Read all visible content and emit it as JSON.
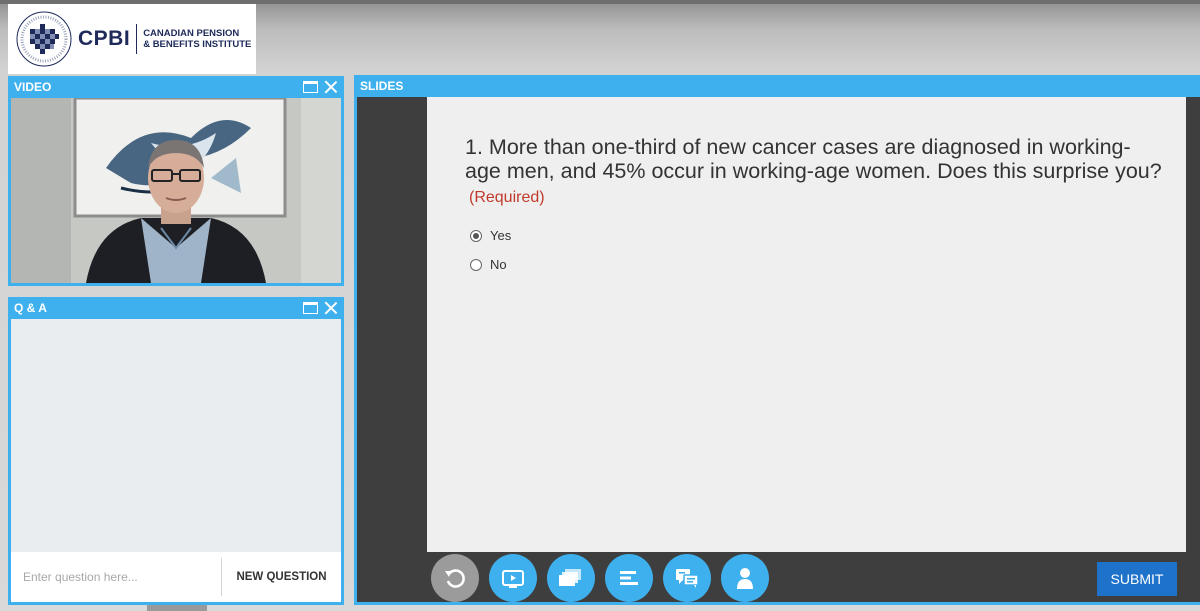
{
  "logo": {
    "abbr": "CPBI",
    "name_line1": "CANADIAN PENSION",
    "name_line2": "& BENEFITS INSTITUTE"
  },
  "video_panel": {
    "title": "VIDEO"
  },
  "qa_panel": {
    "title": "Q & A",
    "input_placeholder": "Enter question here...",
    "new_question_label": "NEW QUESTION"
  },
  "slides_panel": {
    "title": "SLIDES",
    "question": {
      "text": "1. More than one-third of new cancer cases are diagnosed in working-age men, and 45% occur in working-age women. Does this surprise you?",
      "required_label": "(Required)",
      "options": [
        {
          "label": "Yes",
          "selected": true
        },
        {
          "label": "No",
          "selected": false
        }
      ]
    },
    "toolbar": {
      "buttons": [
        {
          "icon": "replay-icon",
          "disabled": true
        },
        {
          "icon": "video-icon",
          "disabled": false
        },
        {
          "icon": "slides-icon",
          "disabled": false
        },
        {
          "icon": "agenda-icon",
          "disabled": false
        },
        {
          "icon": "chat-icon",
          "disabled": false
        },
        {
          "icon": "presenter-icon",
          "disabled": false
        }
      ],
      "submit_label": "SUBMIT"
    }
  },
  "colors": {
    "accent": "#3fb0ee",
    "submit": "#1f72c9",
    "required": "#c0392b",
    "dark": "#3e3e3e"
  }
}
